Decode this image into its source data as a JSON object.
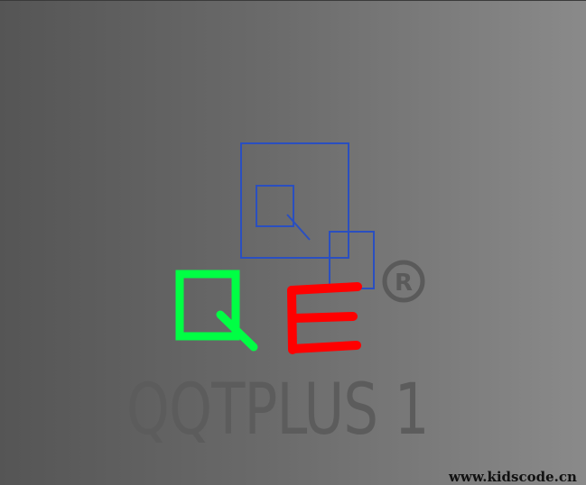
{
  "logo": {
    "letter_q": "Q",
    "letter_e": "E",
    "registered_mark": "®",
    "colors": {
      "q": "#00ff44",
      "e": "#ff0000",
      "squares": "#2a4fc0",
      "registered": "#5a5a5a"
    }
  },
  "product": {
    "title": "QQTPLUS 1"
  },
  "watermark": {
    "text": "www.kidscode.cn"
  },
  "background": {
    "gradient_start": "#555555",
    "gradient_end": "#8a8a8a"
  }
}
